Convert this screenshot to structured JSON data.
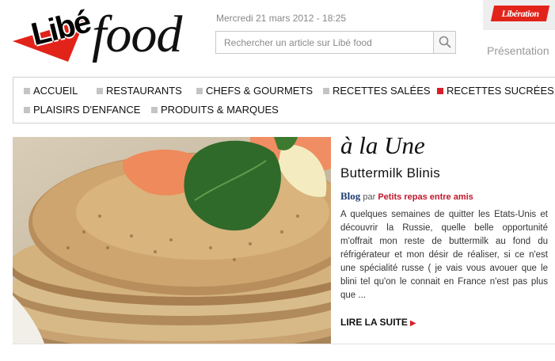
{
  "header": {
    "logo_libe": "Libé",
    "logo_food": "food",
    "date": "Mercredi 21 mars 2012 - 18:25",
    "search_placeholder": "Rechercher un article sur Libé food",
    "liberation_logo": "Libération",
    "presentation_link": "Présentation"
  },
  "nav": {
    "items": [
      {
        "label": "Accueil",
        "active": false
      },
      {
        "label": "Restaurants",
        "active": false
      },
      {
        "label": "Chefs & Gourmets",
        "active": false
      },
      {
        "label": "Recettes salées",
        "active": false
      },
      {
        "label": "Recettes sucrées",
        "active": true
      },
      {
        "label": "Plaisirs d'enfance",
        "active": false
      },
      {
        "label": "Produits & marques",
        "active": false
      }
    ]
  },
  "featured": {
    "section_title": "à la Une",
    "title": "Buttermilk Blinis",
    "blog_label": "Blog",
    "by_text": "par",
    "category": "Petits repas entre amis",
    "excerpt": "A quelques semaines de quitter les Etats-Unis et découvrir la Russie, quelle belle opportunité m'offrait mon reste de buttermilk au fond du réfrigérateur et mon désir de réaliser, si ce n'est une spécialité russe ( je vais vous avouer que le blini tel qu'on le connait en France n'est pas plus que ...",
    "read_more": "Lire la suite",
    "image_alt": "blinis-photo"
  },
  "colors": {
    "accent_red": "#d61f2b",
    "blog_blue": "#1d3c6e",
    "nav_square": "#c4c4c4"
  }
}
